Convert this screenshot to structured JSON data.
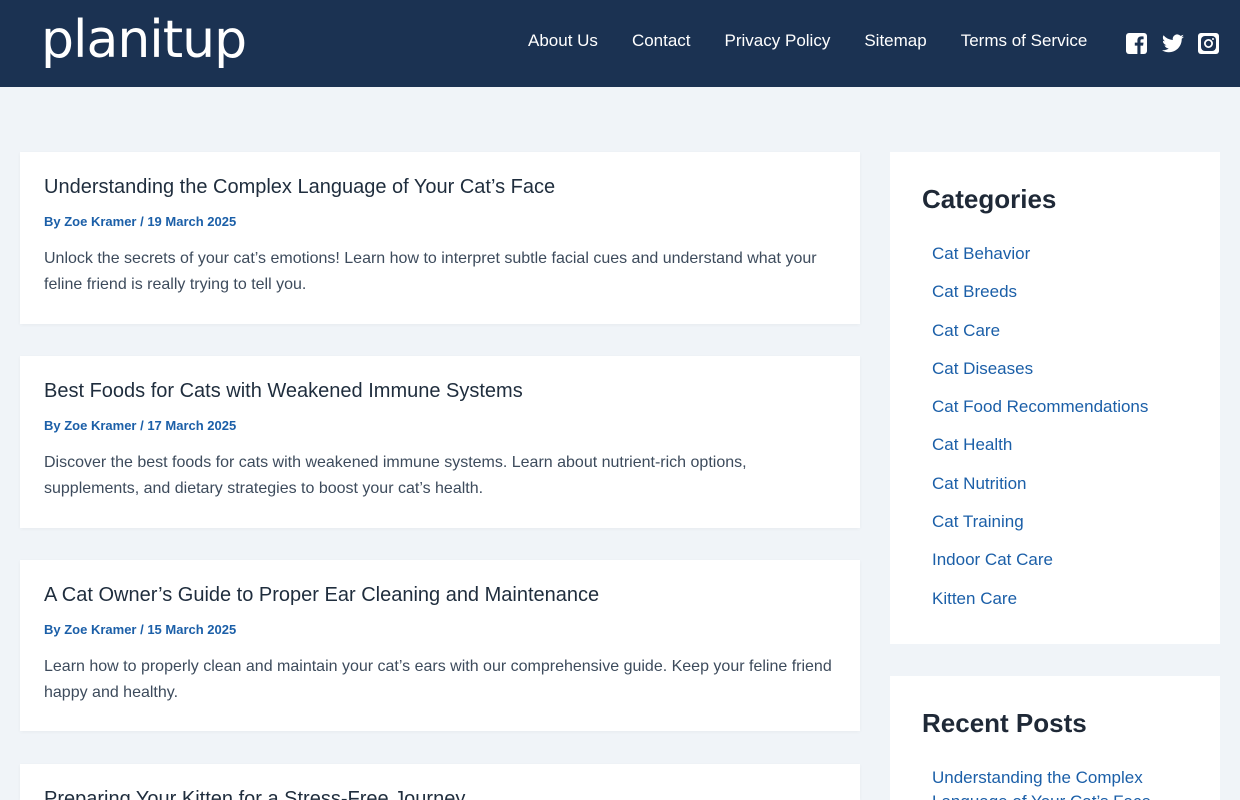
{
  "header": {
    "logo": "planitup",
    "nav": [
      "About Us",
      "Contact",
      "Privacy Policy",
      "Sitemap",
      "Terms of Service"
    ],
    "social": [
      "facebook-icon",
      "twitter-icon",
      "instagram-icon"
    ]
  },
  "articles": [
    {
      "title": "Understanding the Complex Language of Your Cat’s Face",
      "meta": "By Zoe Kramer / 19 March 2025",
      "excerpt": "Unlock the secrets of your cat’s emotions! Learn how to interpret subtle facial cues and understand what your feline friend is really trying to tell you."
    },
    {
      "title": "Best Foods for Cats with Weakened Immune Systems",
      "meta": "By Zoe Kramer / 17 March 2025",
      "excerpt": "Discover the best foods for cats with weakened immune systems. Learn about nutrient-rich options, supplements, and dietary strategies to boost your cat’s health."
    },
    {
      "title": "A Cat Owner’s Guide to Proper Ear Cleaning and Maintenance",
      "meta": "By Zoe Kramer / 15 March 2025",
      "excerpt": "Learn how to properly clean and maintain your cat’s ears with our comprehensive guide. Keep your feline friend happy and healthy."
    },
    {
      "title": "Preparing Your Kitten for a Stress-Free Journey",
      "meta": "",
      "excerpt": ""
    }
  ],
  "sidebar": {
    "categories_title": "Categories",
    "categories": [
      "Cat Behavior",
      "Cat Breeds",
      "Cat Care",
      "Cat Diseases",
      "Cat Food Recommendations",
      "Cat Health",
      "Cat Nutrition",
      "Cat Training",
      "Indoor Cat Care",
      "Kitten Care"
    ],
    "recent_title": "Recent Posts",
    "recent": [
      "Understanding the Complex Language of Your Cat’s Face"
    ]
  },
  "colors": {
    "header_bg": "#1b3252",
    "link": "#1b5fa8",
    "page_bg": "#f0f4f8"
  }
}
